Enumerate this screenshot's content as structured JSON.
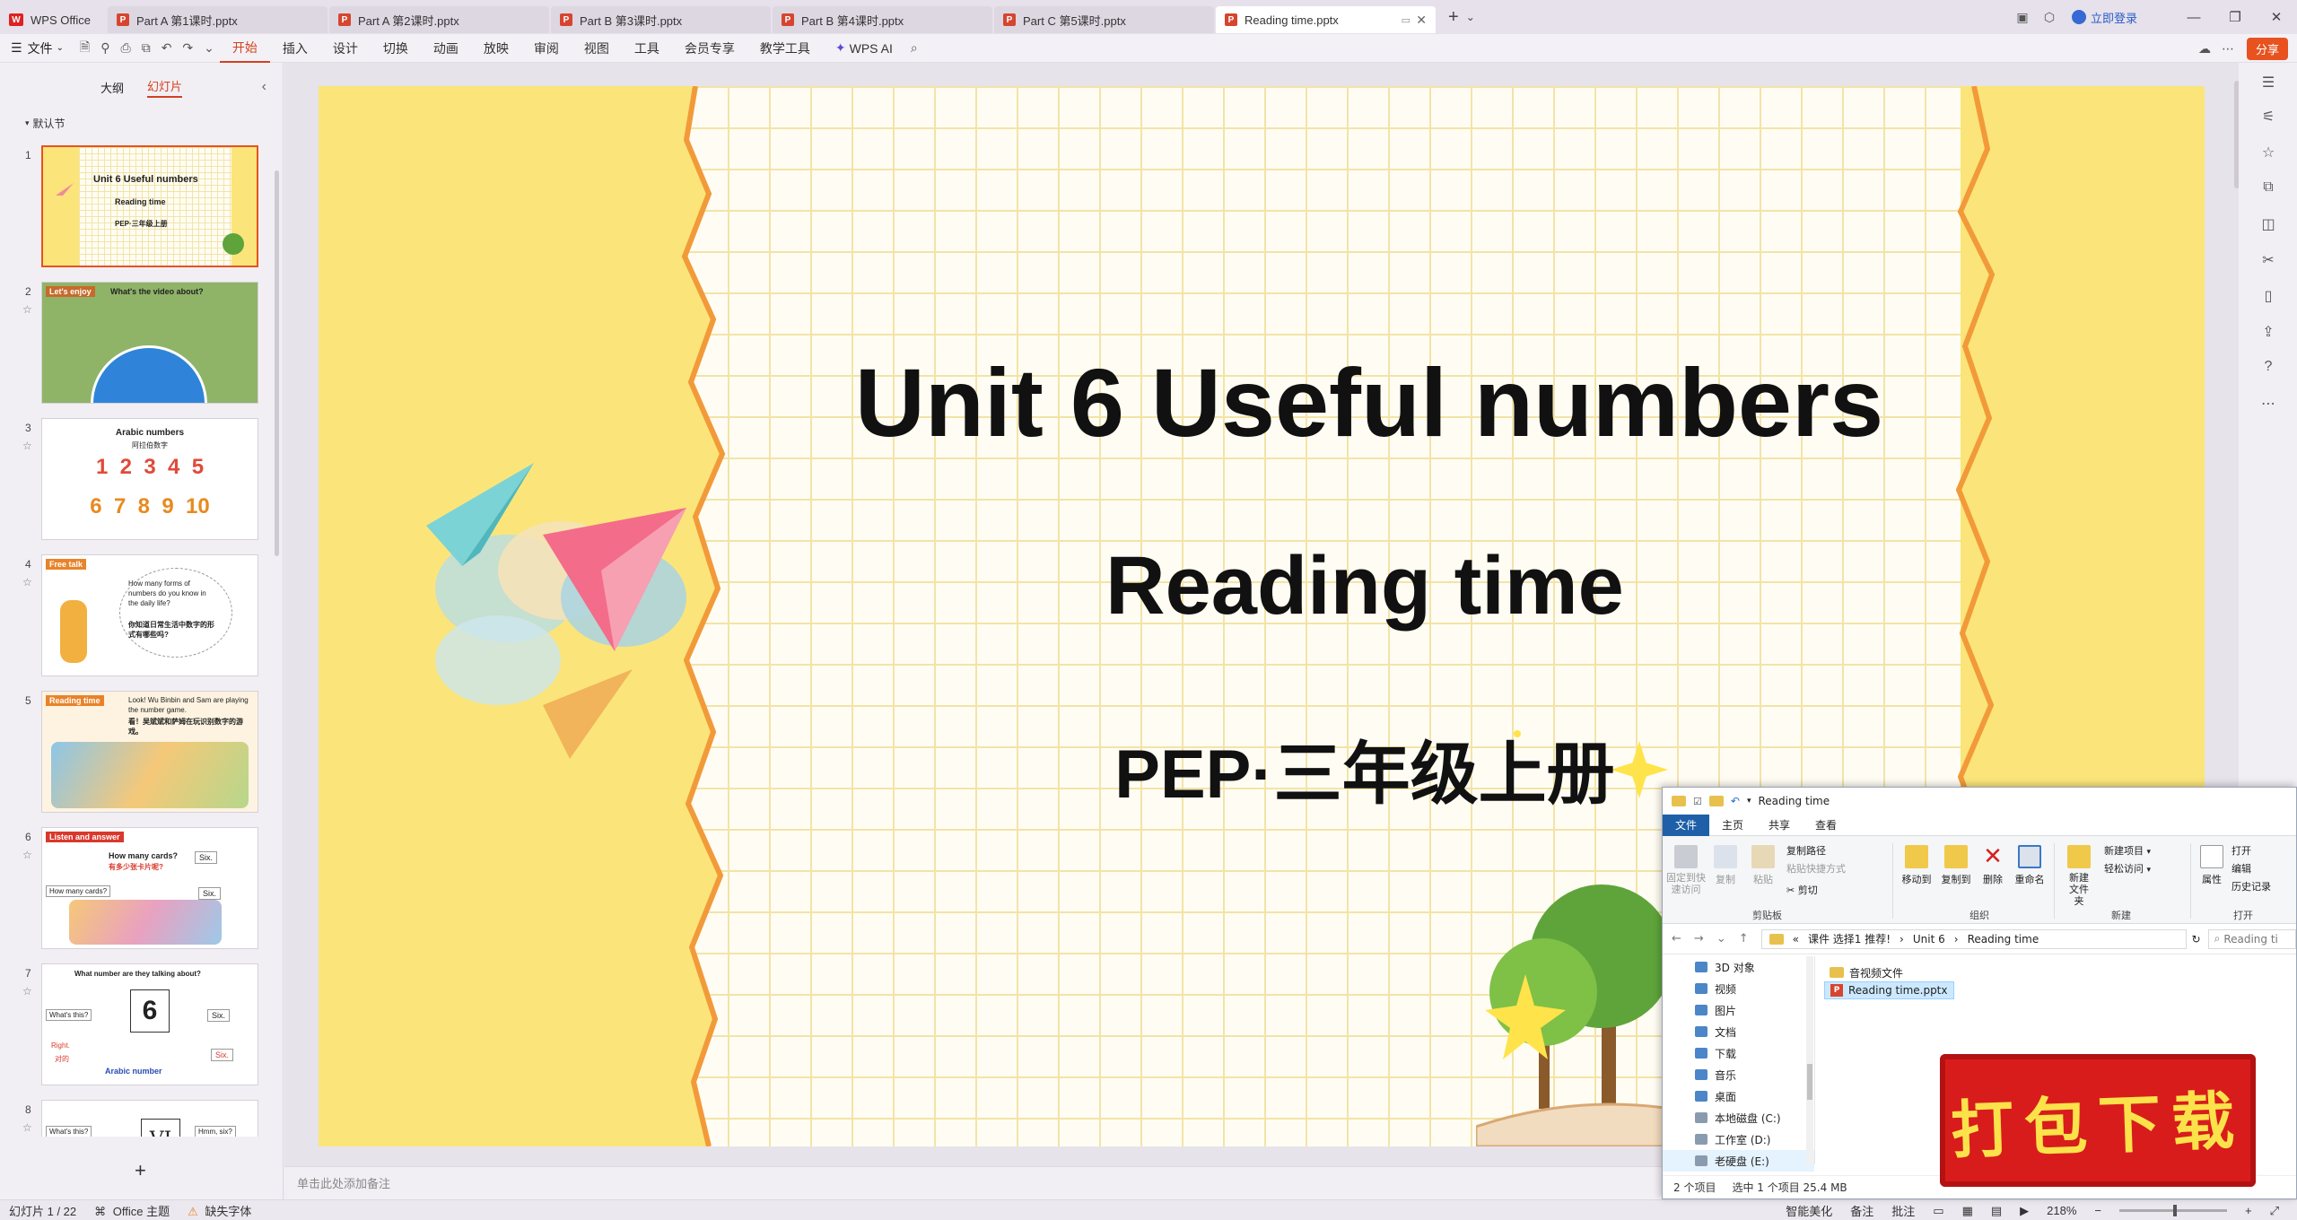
{
  "tabs": {
    "home": "WPS Office",
    "docs": [
      "Part A 第1课时.pptx",
      "Part A 第2课时.pptx",
      "Part B 第3课时.pptx",
      "Part B 第4课时.pptx",
      "Part C 第5课时.pptx",
      "Reading time.pptx"
    ],
    "login": "立即登录"
  },
  "menu": {
    "file": "文件",
    "items": [
      "开始",
      "插入",
      "设计",
      "切换",
      "动画",
      "放映",
      "审阅",
      "视图",
      "工具",
      "会员专享",
      "教学工具",
      "WPS AI"
    ],
    "share": "分享"
  },
  "panel": {
    "tab_outline": "大纲",
    "tab_slides": "幻灯片",
    "section": "默认节",
    "thumbs": [
      {
        "num": "1",
        "lines": [
          "Unit 6 Useful numbers",
          "Reading time",
          "PEP·三年级上册"
        ]
      },
      {
        "num": "2",
        "lines": [
          "Let's enjoy",
          "What's the video about?"
        ]
      },
      {
        "num": "3",
        "lines": [
          "Arabic numbers",
          "阿拉伯数字",
          "1  2  3  4  5",
          "6  7  8  9  10"
        ]
      },
      {
        "num": "4",
        "lines": [
          "Free talk",
          "How many forms of numbers do you know in the daily life?",
          "你知道日常生活中数字的形式有哪些吗?"
        ]
      },
      {
        "num": "5",
        "lines": [
          "Reading time",
          "Look!  Wu Binbin and Sam are playing the number game.",
          "看！吴斌斌和萨姆在玩识别数字的游戏。"
        ]
      },
      {
        "num": "6",
        "lines": [
          "Listen and answer",
          "How many cards?",
          "有多少张卡片呢?",
          "Six.",
          "How many cards?",
          "Six."
        ]
      },
      {
        "num": "7",
        "lines": [
          "What number are they talking about?",
          "What's this?",
          "6",
          "Six.",
          "Right.",
          "对的",
          "Six.",
          "Arabic number"
        ]
      },
      {
        "num": "8",
        "lines": [
          "What's this?",
          "VI",
          "Hmm, six?"
        ]
      }
    ]
  },
  "slide": {
    "title": "Unit 6 Useful numbers",
    "subtitle": "Reading time",
    "grade": "PEP·三年级上册"
  },
  "notes_placeholder": "单击此处添加备注",
  "status": {
    "slide_count": "幻灯片 1 / 22",
    "theme": "Office 主题",
    "missing_font": "缺失字体",
    "smart": "智能美化",
    "notes": "备注",
    "comment": "批注",
    "zoom": "218%"
  },
  "explorer": {
    "title": "Reading time",
    "tabs": [
      "文件",
      "主页",
      "共享",
      "查看"
    ],
    "ribbon": {
      "pin": "固定到快速访问",
      "copy": "复制",
      "paste": "粘贴",
      "copy_path": "复制路径",
      "paste_shortcut": "粘贴快捷方式",
      "cut": "剪切",
      "clipboard": "剪贴板",
      "move_to": "移动到",
      "copy_to": "复制到",
      "delete": "删除",
      "rename": "重命名",
      "organize": "组织",
      "new_folder": "新建文件夹",
      "new_item": "新建项目",
      "easy_access": "轻松访问",
      "new": "新建",
      "properties": "属性",
      "open": "打开",
      "edit": "编辑",
      "history": "历史记录",
      "open_group": "打开"
    },
    "address": [
      "«",
      "课件 选择1 推荐!",
      "Unit 6",
      "Reading time"
    ],
    "search_placeholder": "Reading ti",
    "nav": [
      "3D 对象",
      "视频",
      "图片",
      "文档",
      "下载",
      "音乐",
      "桌面",
      "本地磁盘 (C:)",
      "工作室 (D:)",
      "老硬盘 (E:)"
    ],
    "files": [
      "音视频文件",
      "Reading time.pptx"
    ],
    "status_items": "2 个项目",
    "status_selected": "选中 1 个项目  25.4 MB"
  },
  "stamp": "打包下载",
  "colors": {
    "accent": "#d1421f",
    "slide_bg": "#fbe57a",
    "grid_line": "#f3e3a8",
    "torn_edge": "#f29a3a",
    "stamp_bg": "#d81c1c",
    "stamp_text": "#fbe24a"
  }
}
